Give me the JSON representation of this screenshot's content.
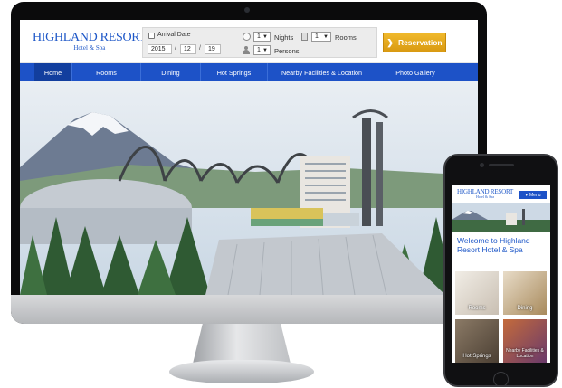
{
  "desktop": {
    "logo": {
      "title": "HIGHLAND RESORT",
      "subtitle": "Hotel & Spa"
    },
    "booking": {
      "arrival_label": "Arrival Date",
      "year": "2015",
      "month": "12",
      "day": "19",
      "separator": "/",
      "nights_value": "1",
      "nights_label": "Nights",
      "rooms_value": "1",
      "rooms_label": "Rooms",
      "persons_value": "1",
      "persons_label": "Persons"
    },
    "reservation_button": {
      "label": "Reservation",
      "chevron": "❯"
    },
    "nav": [
      {
        "label": "Home"
      },
      {
        "label": "Rooms"
      },
      {
        "label": "Dining"
      },
      {
        "label": "Hot Springs"
      },
      {
        "label": "Nearby Facilities & Location"
      },
      {
        "label": "Photo Gallery"
      }
    ],
    "nav_active": "Home"
  },
  "mobile": {
    "logo": {
      "title": "HIGHLAND RESORT",
      "subtitle": "Hotel & Spa"
    },
    "menu_button": {
      "label": "Menu",
      "icon": "chevron-down-icon"
    },
    "welcome": "Welcome to Highland Resort Hotel & Spa",
    "tiles": [
      {
        "label": "Rooms"
      },
      {
        "label": "Dining"
      },
      {
        "label": "Hot Springs"
      },
      {
        "label": "Nearby Facilities & Location"
      }
    ]
  },
  "colors": {
    "brand_blue": "#1d52c7",
    "nav_active": "#123e9e",
    "reservation": "#e3a51c"
  }
}
